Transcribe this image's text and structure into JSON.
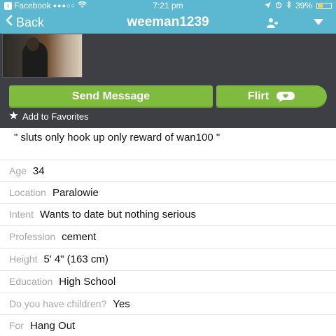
{
  "status_bar": {
    "carrier": "Facebook",
    "signal": "●●●○○",
    "time": "7:21 pm",
    "battery": "39%",
    "battery_level": 0.39
  },
  "nav": {
    "back_label": "Back",
    "title": "weeman1239"
  },
  "actions": {
    "send_message": "Send Message",
    "flirt": "Flirt",
    "add_favorites": "Add to Favorites"
  },
  "profile": {
    "tagline": "\" sluts only hook up only reward of wan100 \"",
    "fields": [
      {
        "label": "Age",
        "value": "34"
      },
      {
        "label": "Location",
        "value": "Paralowie"
      },
      {
        "label": "Intent",
        "value": "Wants to date but nothing serious"
      },
      {
        "label": "Profession",
        "value": "cement"
      },
      {
        "label": "Height",
        "value": "5' 4\" (163 cm)"
      },
      {
        "label": "Education",
        "value": "High School"
      },
      {
        "label": "Do you have children?",
        "value": "Yes"
      },
      {
        "label": "For",
        "value": "Hang Out"
      }
    ]
  },
  "colors": {
    "nav_bg": "#5bb8d0",
    "button_green": "#7fbb3e",
    "dark_panel": "#3e3f44"
  }
}
